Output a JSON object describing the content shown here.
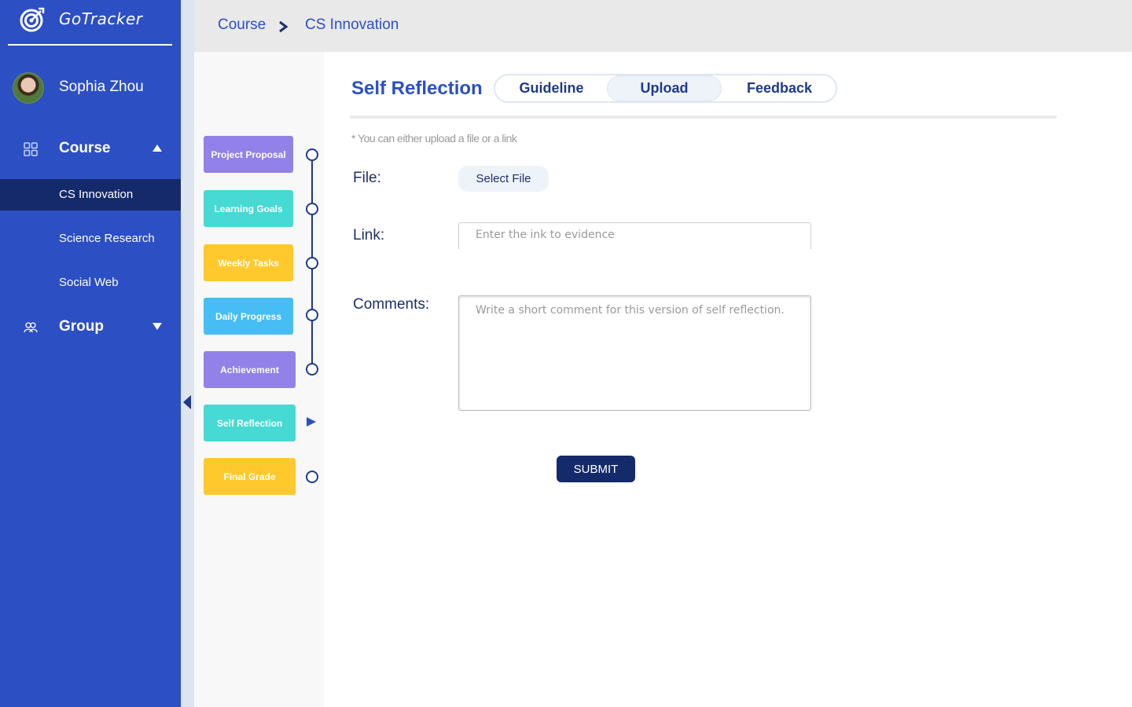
{
  "app": {
    "name": "GoTracker"
  },
  "user": {
    "name": "Sophia Zhou"
  },
  "sidebar": {
    "course": {
      "label": "Course",
      "items": [
        "CS Innovation",
        "Science Research",
        "Social Web"
      ]
    },
    "group": {
      "label": "Group"
    }
  },
  "breadcrumb": {
    "root": "Course",
    "current": "CS Innovation"
  },
  "steps": {
    "items": [
      "Project Proposal",
      "Learning Goals",
      "Weekly Tasks",
      "Daily Progress",
      "Achievement",
      "Self Reflection",
      "Final Grade"
    ],
    "current": "Self Reflection"
  },
  "main": {
    "title": "Self Reflection",
    "tabs": [
      "Guideline",
      "Upload",
      "Feedback"
    ],
    "active_tab": "Upload",
    "hint": "* You can either upload a file or a link",
    "file_label": "File:",
    "select_file": "Select File",
    "link_label": "Link:",
    "link_placeholder": "Enter the ink to evidence",
    "comments_label": "Comments:",
    "comments_placeholder": "Write a short comment for this version of self reflection.",
    "submit": "SUBMIT"
  },
  "colors": {
    "sidebar": "#2c4fc4",
    "sidebar_active": "#152a6b",
    "accent": "#2c4fc4",
    "submit": "#152a6b",
    "step_purple": "#9181e8",
    "step_teal": "#47d9d3",
    "step_yellow": "#ffc92e",
    "step_sky": "#46bdf5"
  },
  "icons": [
    "target-logo-icon",
    "grid-icon",
    "group-icon",
    "chevron-right-icon",
    "caret-up-icon",
    "caret-down-icon",
    "collapse-left-icon",
    "play-pointer-icon"
  ]
}
